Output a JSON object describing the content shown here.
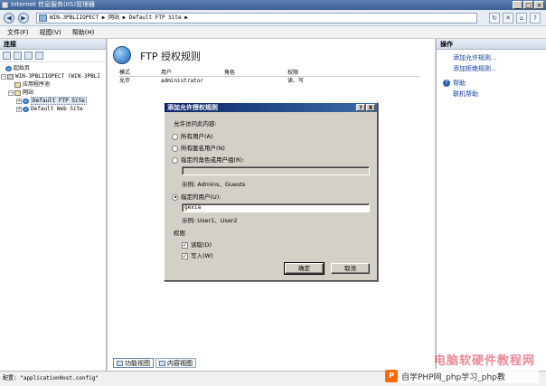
{
  "window": {
    "title": "Internet 信息服务(IIS)管理器",
    "controls": [
      "_",
      "□",
      "×"
    ]
  },
  "address": {
    "path": "WIN-3PBLIIOPECT ▶ 网站 ▶ Default FTP Site ▶"
  },
  "menu": {
    "items": [
      "文件(F)",
      "视图(V)",
      "帮助(H)"
    ]
  },
  "connections": {
    "title": "连接",
    "tree": {
      "start": "起始页",
      "server": "WIN-3PBLIIOPECT (WIN-3PBLI",
      "app_pools": "应用程序池",
      "sites": "网站",
      "ftp_site": "Default FTP Site",
      "web_site": "Default Web Site"
    }
  },
  "main": {
    "title": "FTP 授权规则",
    "columns": [
      "模式",
      "用户",
      "角色",
      "权限"
    ],
    "rows": [
      {
        "mode": "允许",
        "user": "administrator",
        "role": "",
        "perm": "读、写"
      }
    ],
    "tabs": {
      "features": "功能视图",
      "content": "内容视图"
    }
  },
  "actions": {
    "title": "操作",
    "add_allow": "添加允许规则...",
    "add_deny": "添加拒绝规则...",
    "help": "帮助",
    "online_help": "联机帮助"
  },
  "status": {
    "text": "配置: \"applicationHost.config\""
  },
  "dialog": {
    "title": "添加允许授权规则",
    "help_btn": "?",
    "close_btn": "X",
    "access_label": "允许访问此内容:",
    "opt_all_users": "所有用户(A)",
    "opt_anonymous": "所有匿名用户(N)",
    "opt_roles": "指定的角色或用户组(R):",
    "roles_example": "示例: Admins、Guests",
    "opt_users": "指定的用户(U):",
    "users_value": "gexia",
    "users_example": "示例: User1、User2",
    "perm_label": "权限",
    "perm_read": "读取(D)",
    "perm_write": "写入(W)",
    "ok": "确定",
    "cancel": "取消"
  },
  "watermark": {
    "red_text": "电脑软硬件教程网",
    "logo": "P",
    "text": "自学PHP网_php学习_php教"
  }
}
